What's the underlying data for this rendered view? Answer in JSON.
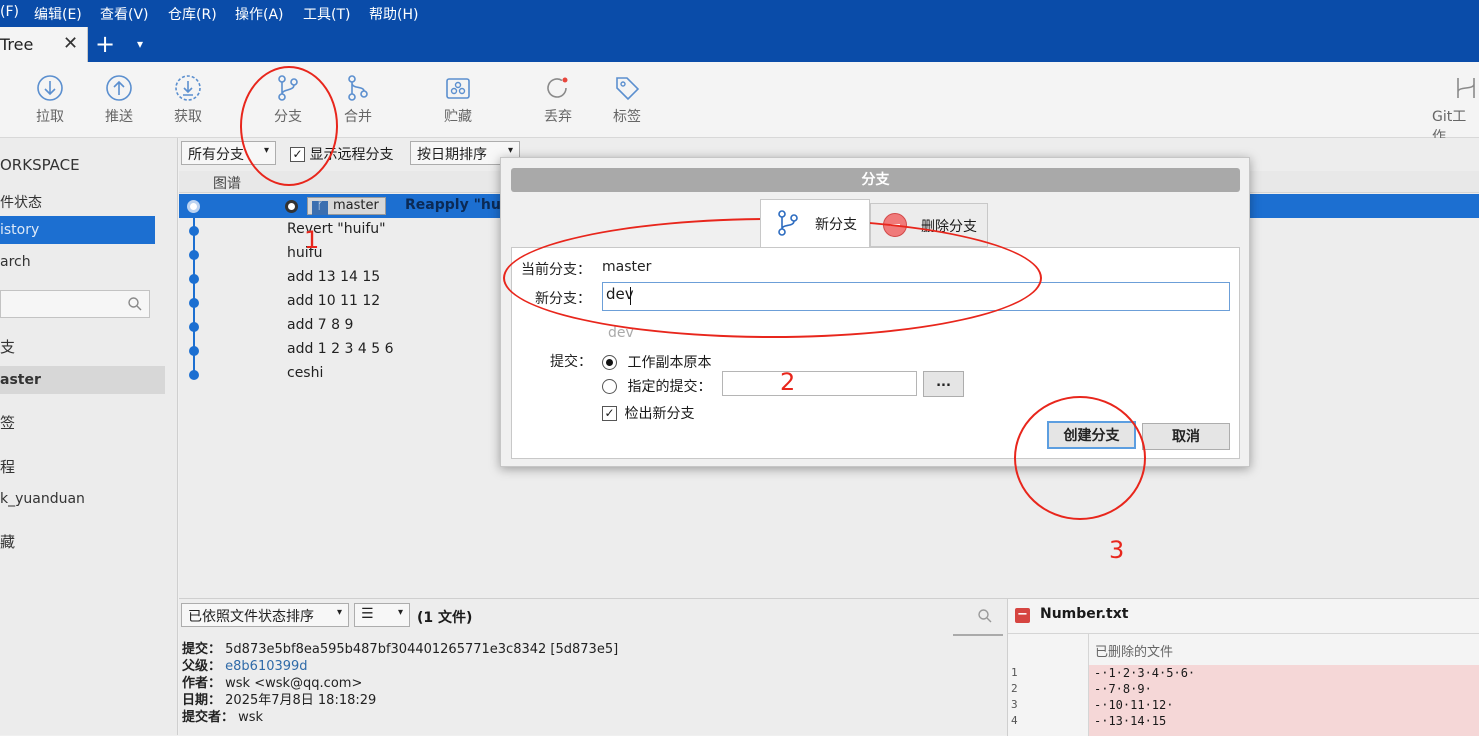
{
  "menu": [
    "(F)",
    "编辑(E)",
    "查看(V)",
    "仓库(R)",
    "操作(A)",
    "工具(T)",
    "帮助(H)"
  ],
  "tab": {
    "title": "Tree",
    "close": "✕",
    "add": "+",
    "dropdown": "▾"
  },
  "toolbar": {
    "pull": "拉取",
    "push": "推送",
    "fetch": "获取",
    "branch": "分支",
    "merge": "合并",
    "stash": "贮藏",
    "discard": "丢弃",
    "tag": "标签",
    "gitflow": "Git工作"
  },
  "sidebar": {
    "workspace": "ORKSPACE",
    "file_status": "件状态",
    "history": "istory",
    "search": "arch",
    "branches": "支",
    "master": "aster",
    "tags": "签",
    "remotes": "程",
    "remote_name": "k_yuanduan",
    "stashes": "藏"
  },
  "filters": {
    "branches": "所有分支",
    "show_remote": "显示远程分支",
    "sort": "按日期排序",
    "graph_col": "图谱"
  },
  "commits": [
    {
      "branch": "master",
      "message": "Reapply \"hui"
    },
    {
      "message": "Revert \"huifu\""
    },
    {
      "message": "huifu"
    },
    {
      "message": "add 13 14 15"
    },
    {
      "message": "add 10 11 12"
    },
    {
      "message": "add 7 8 9"
    },
    {
      "message": "add 1 2 3 4 5 6"
    },
    {
      "message": "ceshi"
    }
  ],
  "bottom": {
    "sort": "已依照文件状态排序",
    "list_icon": "☰",
    "file_count": "(1 文件)",
    "file_name": "Number.txt",
    "deleted_header": "已删除的文件",
    "line_numbers": [
      "1",
      "2",
      "3",
      "4"
    ],
    "diff_lines": [
      "-·1·2·3·4·5·6·",
      "-·7·8·9·",
      "-·10·11·12·",
      "-·13·14·15"
    ],
    "info_labels": {
      "commit": "提交：",
      "parent": "父级：",
      "author": "作者：",
      "date": "日期：",
      "committer": "提交者："
    },
    "info_values": {
      "commit": "5d873e5bf8ea595b487bf304401265771e3c8342 [5d873e5]",
      "parent": "e8b610399d",
      "author": "wsk <wsk@qq.com>",
      "date": "2025年7月8日 18:18:29",
      "committer": "wsk"
    }
  },
  "dialog": {
    "title": "分支",
    "tab_new": "新分支",
    "tab_delete": "删除分支",
    "current_label": "当前分支：",
    "current_value": "master",
    "new_label": "新分支：",
    "new_value": "dev",
    "suggestion": "dev",
    "commit_label": "提交：",
    "radio_working": "工作副本原本",
    "radio_specified": "指定的提交：",
    "browse": "...",
    "checkout": "检出新分支",
    "create": "创建分支",
    "cancel": "取消"
  },
  "annotations": {
    "n1": "1",
    "n2": "2",
    "n3": "3"
  },
  "colors": {
    "accent": "#0a4ca9",
    "selection": "#1c6fd1",
    "annotation": "#e8261c",
    "deleted": "#f5d7d7"
  }
}
